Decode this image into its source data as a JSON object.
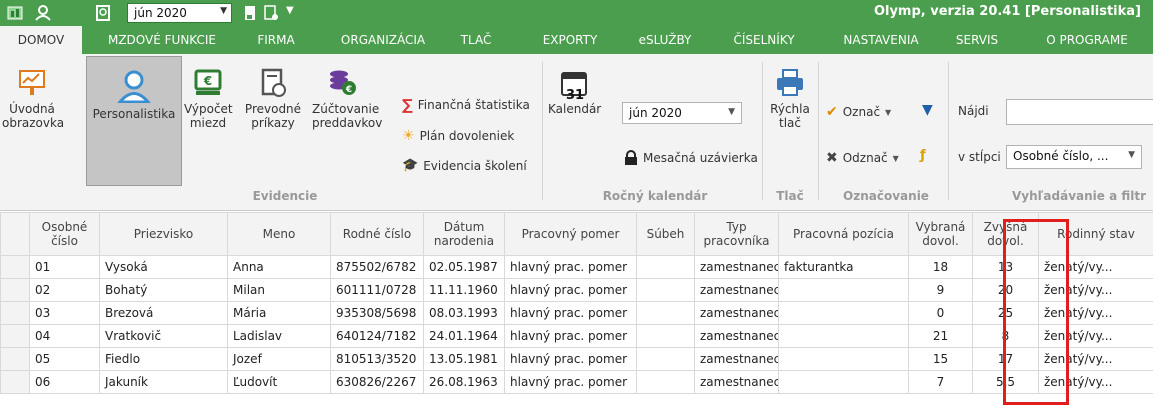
{
  "titlebar": {
    "period": "jún 2020",
    "app_title": "Olymp, verzia 20.41 [Personalistika]"
  },
  "menu": {
    "tabs": [
      "DOMOV",
      "MZDOVÉ FUNKCIE",
      "FIRMA",
      "ORGANIZÁCIA",
      "TLAČ",
      "EXPORTY",
      "eSLUŽBY",
      "ČÍSELNÍKY",
      "NASTAVENIA",
      "SERVIS",
      "O PROGRAME"
    ],
    "active": "DOMOV"
  },
  "ribbon": {
    "evidencie": {
      "uvodna": "Úvodná obrazovka",
      "personalistika": "Personalistika",
      "vypocet": "Výpočet miezd",
      "prevodne": "Prevodné príkazy",
      "zuctovanie": "Zúčtovanie preddavkov",
      "financna": "Finančná štatistika",
      "plan": "Plán dovoleniek",
      "skolenia": "Evidencia školení",
      "label": "Evidencie"
    },
    "kalendar": {
      "day": "31",
      "kalendar": "Kalendár",
      "period": "jún 2020",
      "uzavierka": "Mesačná uzávierka",
      "label": "Ročný kalendár"
    },
    "tlac": {
      "rychla": "Rýchla tlač",
      "label": "Tlač"
    },
    "oznacovanie": {
      "oznac": "Označ",
      "odznac": "Odznač",
      "label": "Označovanie"
    },
    "vyhladavanie": {
      "najdi": "Nájdi",
      "v_stlpci": "v stĺpci",
      "column": "Osobné číslo, ...",
      "label": "Vyhľadávanie a filtr"
    }
  },
  "table": {
    "headers": [
      "Osobné číslo",
      "Priezvisko",
      "Meno",
      "Rodné číslo",
      "Dátum narodenia",
      "Pracovný pomer",
      "Súbeh",
      "Typ pracovníka",
      "Pracovná pozícia",
      "Vybraná dovol.",
      "Zvyšná dovol.",
      "Rodinný stav"
    ],
    "rows": [
      [
        "01",
        "Vysoká",
        "Anna",
        "875502/6782",
        "02.05.1987",
        "hlavný prac. pomer",
        "",
        "zamestnanec",
        "fakturantka",
        "18",
        "13",
        "ženatý/vy..."
      ],
      [
        "02",
        "Bohatý",
        "Milan",
        "601111/0728",
        "11.11.1960",
        "hlavný prac. pomer",
        "",
        "zamestnanec",
        "",
        "9",
        "20",
        "ženatý/vy..."
      ],
      [
        "03",
        "Brezová",
        "Mária",
        "935308/5698",
        "08.03.1993",
        "hlavný prac. pomer",
        "",
        "zamestnanec",
        "",
        "0",
        "25",
        "ženatý/vy..."
      ],
      [
        "04",
        "Vratkovič",
        "Ladislav",
        "640124/7182",
        "24.01.1964",
        "hlavný prac. pomer",
        "",
        "zamestnanec",
        "",
        "21",
        "8",
        "ženatý/vy..."
      ],
      [
        "05",
        "Fiedlo",
        "Jozef",
        "810513/3520",
        "13.05.1981",
        "hlavný prac. pomer",
        "",
        "zamestnanec",
        "",
        "15",
        "17",
        "ženatý/vy..."
      ],
      [
        "06",
        "Jakuník",
        "Ľudovít",
        "630826/2267",
        "26.08.1963",
        "hlavný prac. pomer",
        "",
        "zamestnanec",
        "",
        "7",
        "5,5",
        "ženatý/vy..."
      ]
    ]
  },
  "colors": {
    "brand": "#4a9e4d",
    "highlight": "#e11e1e"
  }
}
